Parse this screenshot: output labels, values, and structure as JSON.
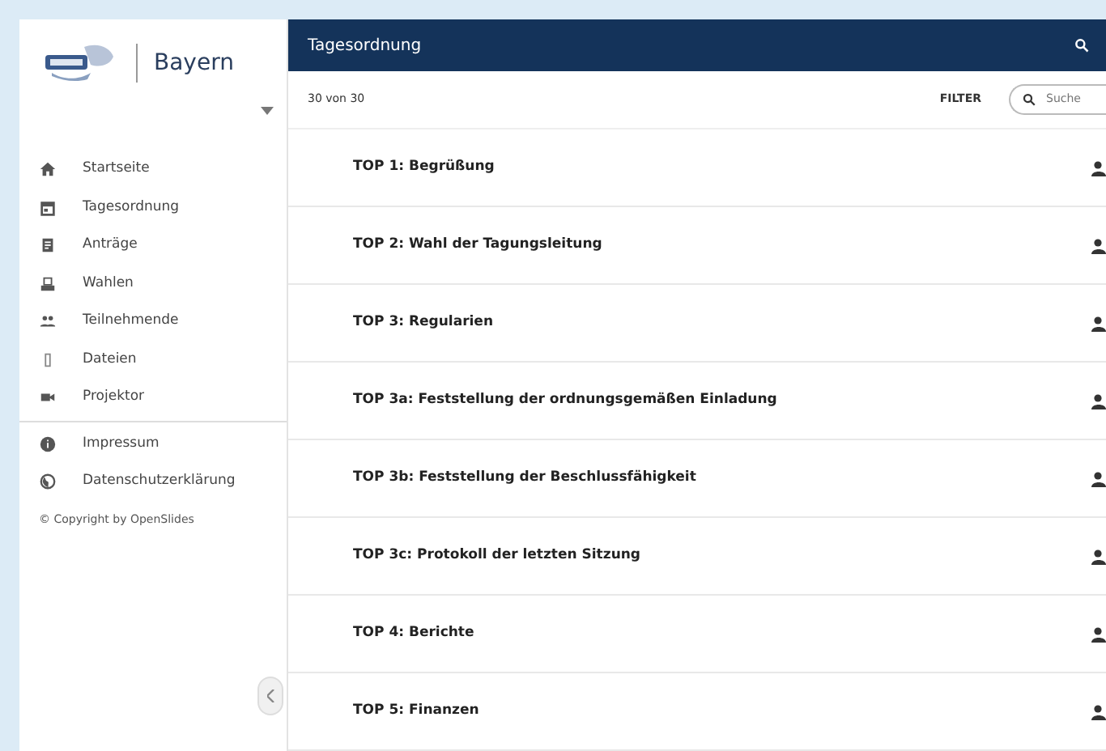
{
  "sidebar": {
    "brand": "Bayern",
    "nav": [
      {
        "label": "Startseite"
      },
      {
        "label": "Tagesordnung"
      },
      {
        "label": "Anträge"
      },
      {
        "label": "Wahlen"
      },
      {
        "label": "Teilnehmende"
      },
      {
        "label": "Dateien"
      },
      {
        "label": "Projektor"
      }
    ],
    "legal": [
      {
        "label": "Impressum"
      },
      {
        "label": "Datenschutzerklärung"
      }
    ],
    "copyright": "© Copyright by OpenSlides"
  },
  "header": {
    "title": "Tagesordnung"
  },
  "toolbar": {
    "count": "30 von 30",
    "filter": "FILTER",
    "search": {
      "placeholder": "Suche"
    }
  },
  "agenda": [
    {
      "title": "TOP 1: Begrüßung"
    },
    {
      "title": "TOP 2: Wahl der Tagungsleitung"
    },
    {
      "title": "TOP 3: Regularien"
    },
    {
      "title": "TOP 3a: Feststellung der ordnungsgemäßen Einladung"
    },
    {
      "title": "TOP 3b: Feststellung der Beschlussfähigkeit"
    },
    {
      "title": "TOP 3c: Protokoll der letzten Sitzung"
    },
    {
      "title": "TOP 4: Berichte"
    },
    {
      "title": "TOP 5: Finanzen"
    }
  ]
}
